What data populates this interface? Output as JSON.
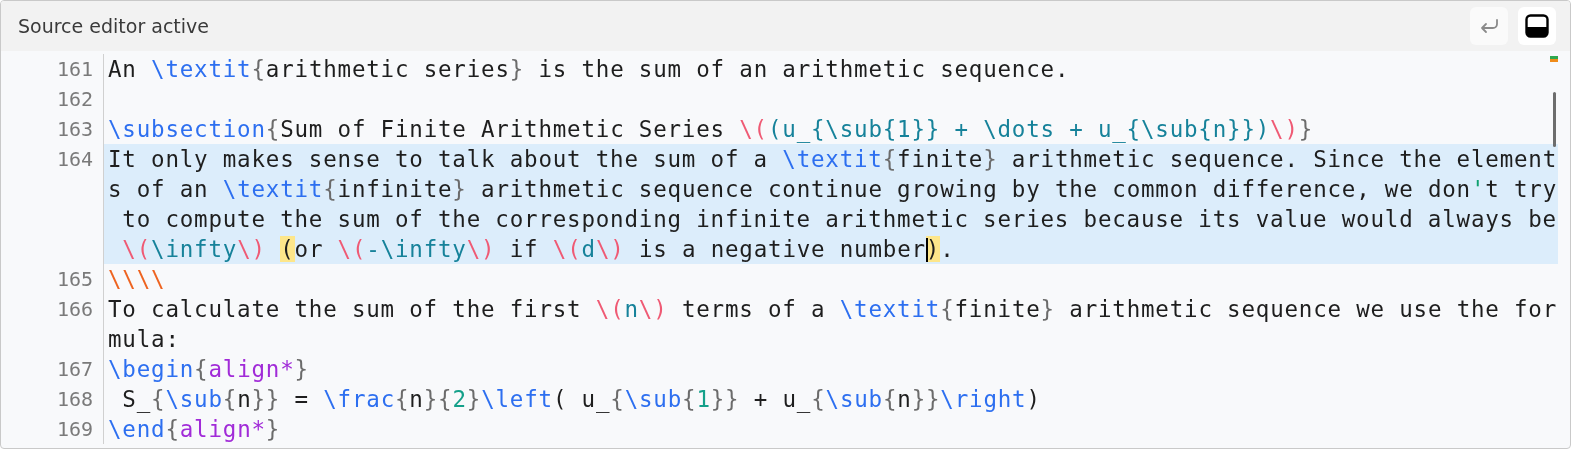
{
  "header": {
    "title": "Source editor active",
    "buttons": [
      {
        "kind": "wrap"
      },
      {
        "kind": "panel"
      }
    ]
  },
  "editor": {
    "lines": [
      {
        "number": "161",
        "selected": false,
        "rows": [
          {
            "spans": [
              {
                "text": "An ",
                "kind": "plain"
              },
              {
                "text": "\\textit",
                "kind": "command"
              },
              {
                "text": "{",
                "kind": "brace"
              },
              {
                "text": "arithmetic series",
                "kind": "plain"
              },
              {
                "text": "}",
                "kind": "brace"
              },
              {
                "text": " is the sum of an arithmetic sequence.",
                "kind": "plain"
              }
            ]
          }
        ]
      },
      {
        "number": "162",
        "selected": false
      },
      {
        "number": "163",
        "selected": false,
        "rows": [
          {
            "spans": [
              {
                "text": "\\subsection",
                "kind": "command"
              },
              {
                "text": "{",
                "kind": "brace"
              },
              {
                "text": "Sum of Finite Arithmetic Series ",
                "kind": "plain"
              },
              {
                "text": "\\(",
                "kind": "delim"
              },
              {
                "text": "(u_{\\sub{1}} + \\dots + u_{\\sub{n}})",
                "kind": "math"
              },
              {
                "text": "\\)",
                "kind": "delim"
              },
              {
                "text": "}",
                "kind": "brace"
              }
            ]
          }
        ]
      },
      {
        "number": "164",
        "selected": true,
        "rows": [
          {
            "spans": [
              {
                "text": "It only makes sense to talk about the sum of a ",
                "kind": "plain"
              },
              {
                "text": "\\textit",
                "kind": "command"
              },
              {
                "text": "{",
                "kind": "brace"
              },
              {
                "text": "finite",
                "kind": "plain"
              },
              {
                "text": "}",
                "kind": "brace"
              },
              {
                "text": " arithmetic sequence. Since the element",
                "kind": "plain"
              }
            ]
          },
          {
            "spans": [
              {
                "text": "s of an ",
                "kind": "plain"
              },
              {
                "text": "\\textit",
                "kind": "command"
              },
              {
                "text": "{",
                "kind": "brace"
              },
              {
                "text": "infinite",
                "kind": "plain"
              },
              {
                "text": "}",
                "kind": "brace"
              },
              {
                "text": " arithmetic sequence continue growing by the common difference, we don",
                "kind": "plain"
              },
              {
                "text": "'",
                "kind": "quote"
              },
              {
                "text": "t try",
                "kind": "plain"
              }
            ]
          },
          {
            "spans": [
              {
                "text": " to compute the sum of the corresponding infinite arithmetic series because its value would always be",
                "kind": "plain"
              }
            ]
          },
          {
            "spans": [
              {
                "text": " \\(",
                "kind": "delim"
              },
              {
                "text": "\\infty",
                "kind": "math"
              },
              {
                "text": "\\) ",
                "kind": "delim"
              },
              {
                "text": "(",
                "kind": "match"
              },
              {
                "text": "or ",
                "kind": "plain"
              },
              {
                "text": "\\(",
                "kind": "delim"
              },
              {
                "text": "-\\infty",
                "kind": "math"
              },
              {
                "text": "\\)",
                "kind": "delim"
              },
              {
                "text": " if ",
                "kind": "plain"
              },
              {
                "text": "\\(",
                "kind": "delim"
              },
              {
                "text": "d",
                "kind": "math"
              },
              {
                "text": "\\)",
                "kind": "delim"
              },
              {
                "text": " is a negative number",
                "kind": "plain"
              },
              {
                "text": ")",
                "kind": "match",
                "cursor": true
              },
              {
                "text": ".",
                "kind": "plain"
              }
            ]
          }
        ]
      },
      {
        "number": "165",
        "selected": false,
        "rows": [
          {
            "spans": [
              {
                "text": "\\\\\\\\",
                "kind": "escape"
              }
            ]
          }
        ]
      },
      {
        "number": "166",
        "selected": false,
        "rows": [
          {
            "spans": [
              {
                "text": "To calculate the sum of the first ",
                "kind": "plain"
              },
              {
                "text": "\\(",
                "kind": "delim"
              },
              {
                "text": "n",
                "kind": "math"
              },
              {
                "text": "\\)",
                "kind": "delim"
              },
              {
                "text": " terms of a ",
                "kind": "plain"
              },
              {
                "text": "\\textit",
                "kind": "command"
              },
              {
                "text": "{",
                "kind": "brace"
              },
              {
                "text": "finite",
                "kind": "plain"
              },
              {
                "text": "}",
                "kind": "brace"
              },
              {
                "text": " arithmetic sequence we use the for",
                "kind": "plain"
              }
            ]
          },
          {
            "spans": [
              {
                "text": "mula:",
                "kind": "plain"
              }
            ]
          }
        ]
      },
      {
        "number": "167",
        "selected": false,
        "rows": [
          {
            "spans": [
              {
                "text": "\\begin",
                "kind": "command"
              },
              {
                "text": "{",
                "kind": "brace"
              },
              {
                "text": "align*",
                "kind": "env"
              },
              {
                "text": "}",
                "kind": "brace"
              }
            ]
          }
        ]
      },
      {
        "number": "168",
        "selected": false,
        "rows": [
          {
            "spans": [
              {
                "text": " S_",
                "kind": "plain"
              },
              {
                "text": "{",
                "kind": "brace"
              },
              {
                "text": "\\sub",
                "kind": "command"
              },
              {
                "text": "{",
                "kind": "brace"
              },
              {
                "text": "n",
                "kind": "plain"
              },
              {
                "text": "}}",
                "kind": "brace"
              },
              {
                "text": " = ",
                "kind": "plain"
              },
              {
                "text": "\\frac",
                "kind": "command"
              },
              {
                "text": "{",
                "kind": "brace"
              },
              {
                "text": "n",
                "kind": "plain"
              },
              {
                "text": "}{",
                "kind": "brace"
              },
              {
                "text": "2",
                "kind": "digit"
              },
              {
                "text": "}",
                "kind": "brace"
              },
              {
                "text": "\\left",
                "kind": "command"
              },
              {
                "text": "( u_",
                "kind": "plain"
              },
              {
                "text": "{",
                "kind": "brace"
              },
              {
                "text": "\\sub",
                "kind": "command"
              },
              {
                "text": "{",
                "kind": "brace"
              },
              {
                "text": "1",
                "kind": "digit"
              },
              {
                "text": "}}",
                "kind": "brace"
              },
              {
                "text": " + u_",
                "kind": "plain"
              },
              {
                "text": "{",
                "kind": "brace"
              },
              {
                "text": "\\sub",
                "kind": "command"
              },
              {
                "text": "{",
                "kind": "brace"
              },
              {
                "text": "n",
                "kind": "plain"
              },
              {
                "text": "}}",
                "kind": "brace"
              },
              {
                "text": "\\right",
                "kind": "command"
              },
              {
                "text": ")",
                "kind": "plain"
              }
            ]
          }
        ]
      },
      {
        "number": "169",
        "selected": false,
        "rows": [
          {
            "spans": [
              {
                "text": "\\end",
                "kind": "command"
              },
              {
                "text": "{",
                "kind": "brace"
              },
              {
                "text": "align*",
                "kind": "env"
              },
              {
                "text": "}",
                "kind": "brace"
              }
            ]
          }
        ]
      }
    ]
  }
}
